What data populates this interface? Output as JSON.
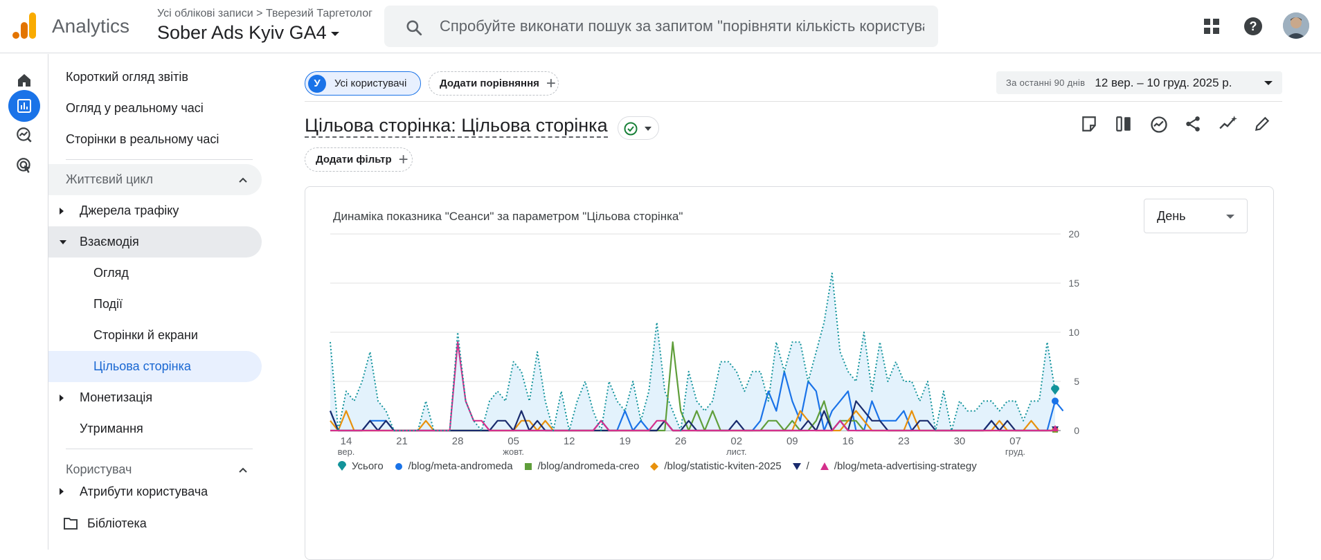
{
  "header": {
    "app_name": "Analytics",
    "breadcrumb_account": "Усі облікові записи",
    "breadcrumb_sep": ">",
    "breadcrumb_property": "Тверезий Таргетолог",
    "property_name": "Sober Ads Kyiv GA4",
    "search_placeholder": "Спробуйте виконати пошук за запитом \"порівняти кількість користувач..."
  },
  "nav": {
    "items": [
      {
        "label": "Короткий огляд звітів"
      },
      {
        "label": "Огляд у реальному часі"
      },
      {
        "label": "Сторінки в реальному часі"
      }
    ],
    "lifecycle": "Життєвий цикл",
    "traffic": "Джерела трафіку",
    "engagement": "Взаємодія",
    "sub": [
      "Огляд",
      "Події",
      "Сторінки й екрани",
      "Цільова сторінка"
    ],
    "monetization": "Монетизація",
    "retention": "Утримання",
    "user": "Користувач",
    "user_attrs": "Атрибути користувача",
    "library": "Бібліотека"
  },
  "toolbar": {
    "segment_letter": "У",
    "segment_label": "Усі користувачі",
    "add_comparison": "Додати порівняння",
    "date_label": "За останні 90 днів",
    "date_value": "12 вер. – 10 груд. 2025 р.",
    "add_filter": "Додати фільтр"
  },
  "page_title": "Цільова сторінка: Цільова сторінка",
  "card": {
    "title": "Динаміка показника \"Сеанси\" за параметром \"Цільова сторінка\"",
    "granularity": "День"
  },
  "colors": {
    "total": "#12939a",
    "andromeda": "#1a73e8",
    "creo": "#5f9e3a",
    "kviten": "#e8910c",
    "root": "#1a2b6d",
    "strategy": "#d4308c"
  },
  "chart_data": {
    "type": "line",
    "ylim": [
      0,
      20
    ],
    "yticks": [
      "0",
      "5",
      "10",
      "15",
      "20"
    ],
    "x_start_label": "12 вер.",
    "xticks": [
      {
        "day": 2,
        "label": "14",
        "sub": "вер."
      },
      {
        "day": 9,
        "label": "21",
        "sub": ""
      },
      {
        "day": 16,
        "label": "28",
        "sub": ""
      },
      {
        "day": 23,
        "label": "05",
        "sub": "жовт."
      },
      {
        "day": 30,
        "label": "12",
        "sub": ""
      },
      {
        "day": 37,
        "label": "19",
        "sub": ""
      },
      {
        "day": 44,
        "label": "26",
        "sub": ""
      },
      {
        "day": 51,
        "label": "02",
        "sub": "лист."
      },
      {
        "day": 58,
        "label": "09",
        "sub": ""
      },
      {
        "day": 65,
        "label": "16",
        "sub": ""
      },
      {
        "day": 72,
        "label": "23",
        "sub": ""
      },
      {
        "day": 79,
        "label": "30",
        "sub": ""
      },
      {
        "day": 86,
        "label": "07",
        "sub": "груд."
      }
    ],
    "series": [
      {
        "name": "Усього",
        "key": "total",
        "values": [
          9,
          0,
          4,
          3,
          5,
          8,
          3,
          2,
          0,
          0,
          0,
          0,
          3,
          0,
          0,
          0,
          10,
          3,
          1,
          0,
          3,
          4,
          3,
          7,
          6,
          3,
          8,
          3,
          0,
          4,
          0,
          3,
          5,
          2,
          0,
          5,
          3,
          2,
          5,
          1,
          4,
          11,
          4,
          2,
          0,
          6,
          3,
          2,
          3,
          7,
          7,
          6,
          4,
          6,
          6,
          3,
          9,
          6,
          9,
          9,
          5,
          8,
          11,
          16,
          8,
          6,
          5,
          10,
          4,
          9,
          5,
          7,
          5,
          5,
          3,
          5,
          0,
          4,
          0,
          3,
          2,
          2,
          3,
          3,
          2,
          3,
          3,
          1,
          3,
          3,
          9,
          4
        ]
      },
      {
        "name": "/blog/meta-andromeda",
        "key": "andromeda",
        "values": [
          2,
          0,
          0,
          0,
          0,
          1,
          1,
          1,
          0,
          0,
          0,
          0,
          0,
          0,
          0,
          0,
          0,
          0,
          0,
          0,
          0,
          0,
          0,
          0,
          0,
          0,
          0,
          0,
          0,
          0,
          0,
          0,
          0,
          0,
          1,
          0,
          0,
          2,
          0,
          1,
          0,
          0,
          1,
          0,
          0,
          0,
          0,
          0,
          0,
          0,
          0,
          0,
          0,
          0,
          1,
          4,
          2,
          6,
          3,
          1,
          5,
          4,
          0,
          2,
          3,
          4,
          0,
          0,
          3,
          1,
          1,
          1,
          2,
          0,
          0,
          0,
          0,
          0,
          0,
          0,
          0,
          0,
          0,
          1,
          0,
          0,
          0,
          0,
          0,
          0,
          0,
          3,
          2
        ]
      },
      {
        "name": "/blog/andromeda-creo",
        "key": "creo",
        "values": [
          0,
          0,
          0,
          0,
          0,
          0,
          0,
          0,
          0,
          0,
          0,
          0,
          0,
          0,
          0,
          0,
          0,
          0,
          0,
          0,
          0,
          0,
          0,
          0,
          0,
          0,
          0,
          0,
          0,
          0,
          0,
          0,
          0,
          0,
          0,
          0,
          0,
          0,
          0,
          0,
          0,
          0,
          0,
          9,
          2,
          0,
          2,
          0,
          2,
          0,
          0,
          0,
          0,
          0,
          0,
          1,
          1,
          0,
          1,
          0,
          0,
          1,
          3,
          0,
          1,
          1,
          1,
          0,
          0,
          0,
          0,
          0,
          0,
          0,
          0,
          0,
          0,
          0,
          0,
          0,
          0,
          0,
          0,
          0,
          0,
          0,
          0,
          0,
          0,
          0,
          0,
          0
        ]
      },
      {
        "name": "/blog/statistic-kviten-2025",
        "key": "kviten",
        "values": [
          1,
          0,
          2,
          0,
          0,
          0,
          0,
          0,
          0,
          0,
          0,
          0,
          1,
          0,
          0,
          0,
          0,
          0,
          0,
          0,
          0,
          0,
          0,
          0,
          1,
          1,
          0,
          1,
          0,
          0,
          0,
          0,
          0,
          0,
          0,
          0,
          0,
          0,
          0,
          0,
          0,
          0,
          1,
          0,
          0,
          0,
          0,
          0,
          0,
          0,
          0,
          0,
          0,
          0,
          0,
          0,
          0,
          0,
          0,
          2,
          1,
          0,
          0,
          0,
          0,
          1,
          2,
          1,
          0,
          0,
          0,
          0,
          0,
          2,
          0,
          0,
          0,
          0,
          0,
          0,
          0,
          0,
          0,
          0,
          1,
          0,
          0,
          0,
          1,
          0,
          0,
          0
        ]
      },
      {
        "name": "/",
        "key": "root",
        "values": [
          2,
          0,
          0,
          0,
          0,
          1,
          0,
          1,
          0,
          0,
          0,
          0,
          0,
          0,
          0,
          0,
          0,
          0,
          0,
          0,
          0,
          1,
          1,
          0,
          2,
          0,
          1,
          0,
          0,
          0,
          0,
          0,
          0,
          0,
          0,
          0,
          0,
          0,
          0,
          0,
          0,
          0,
          1,
          0,
          0,
          1,
          0,
          0,
          0,
          0,
          0,
          1,
          0,
          0,
          0,
          0,
          0,
          0,
          0,
          0,
          1,
          0,
          2,
          0,
          1,
          0,
          3,
          2,
          1,
          1,
          0,
          0,
          0,
          0,
          1,
          1,
          0,
          0,
          0,
          0,
          0,
          0,
          0,
          1,
          0,
          1,
          0,
          0,
          0,
          0,
          0,
          0
        ]
      },
      {
        "name": "/blog/meta-advertising-strategy",
        "key": "strategy",
        "values": [
          0,
          0,
          0,
          0,
          0,
          0,
          0,
          0,
          0,
          0,
          0,
          0,
          0,
          0,
          0,
          0,
          9,
          3,
          1,
          1,
          0,
          0,
          0,
          0,
          0,
          0,
          0,
          0,
          0,
          0,
          0,
          0,
          0,
          0,
          1,
          0,
          0,
          0,
          0,
          0,
          0,
          1,
          1,
          0,
          0,
          0,
          0,
          0,
          0,
          0,
          0,
          0,
          0,
          0,
          0,
          0,
          0,
          0,
          0,
          0,
          0,
          0,
          0,
          0,
          1,
          0,
          0,
          0,
          0,
          0,
          0,
          0,
          0,
          0,
          0,
          0,
          0,
          0,
          0,
          0,
          0,
          0,
          0,
          0,
          0,
          0,
          0,
          0,
          0,
          0,
          0,
          0
        ]
      }
    ]
  }
}
